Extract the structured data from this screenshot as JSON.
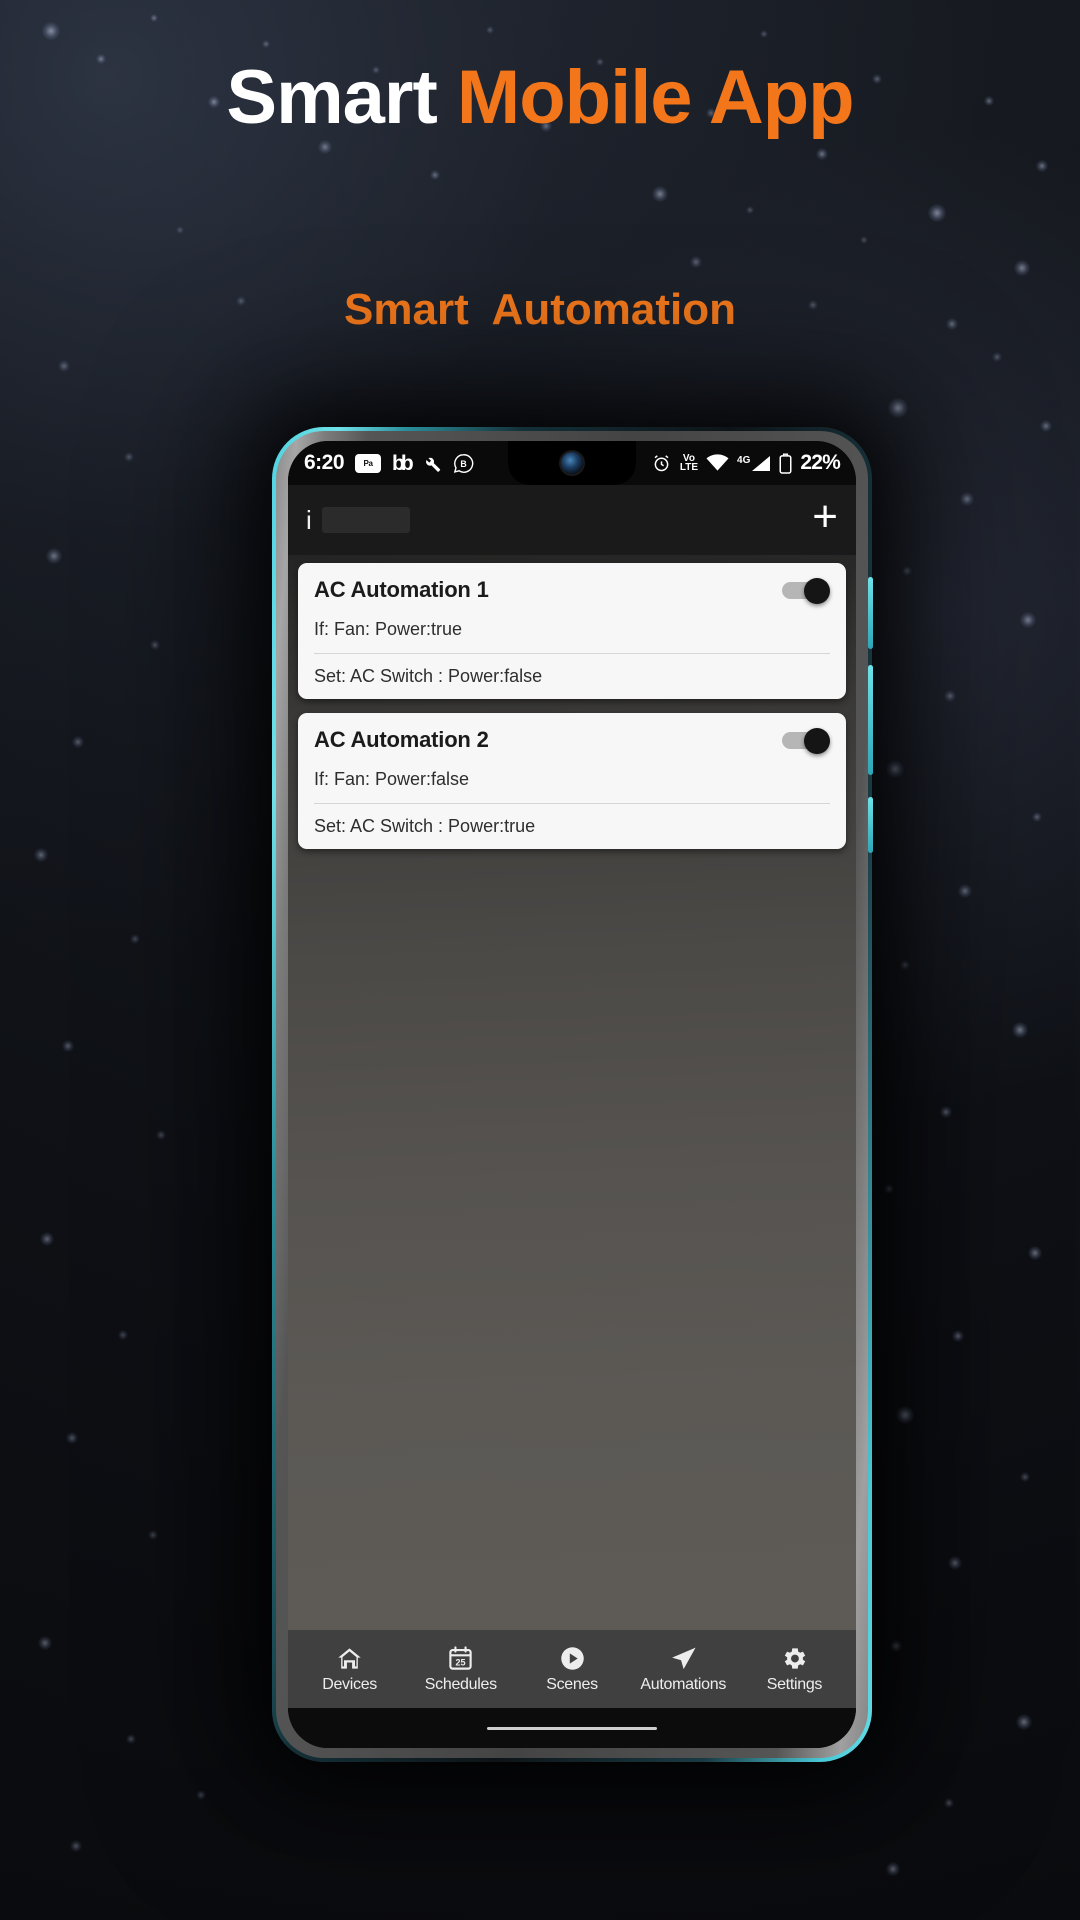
{
  "page": {
    "title_part_white": "Smart ",
    "title_part_orange": "Mobile App",
    "subtitle": "Smart  Automation",
    "colors": {
      "accent_orange": "#f4761b",
      "title_white": "#ffffff",
      "phone_bezel_cyan": "#4fd4e0",
      "card_background": "#f7f7f7",
      "nav_background": "#404040"
    }
  },
  "phone": {
    "status_bar": {
      "clock": "6:20",
      "left_icons": [
        {
          "name": "paytm-icon",
          "label": "Paytm"
        },
        {
          "name": "bb-icon",
          "label": "bb"
        },
        {
          "name": "wrench-icon",
          "label": "wrench"
        },
        {
          "name": "whatsapp-business-icon",
          "label": "B"
        }
      ],
      "right_icons": [
        {
          "name": "alarm-icon",
          "label": "alarm"
        },
        {
          "name": "volte-icon",
          "label": "VoLTE"
        },
        {
          "name": "wifi-icon",
          "label": "wifi"
        },
        {
          "name": "network-4g-icon",
          "label": "4G"
        },
        {
          "name": "battery-icon",
          "label": "battery"
        }
      ],
      "network_label": "4G",
      "volte_top": "Vo",
      "volte_bottom": "LTE",
      "battery_percent": "22%"
    },
    "app_header": {
      "info_label": "i",
      "add_label": "+"
    },
    "automations": [
      {
        "title": "AC Automation 1",
        "if_text": "If: Fan: Power:true",
        "set_text": "Set: AC Switch : Power:false",
        "enabled": true
      },
      {
        "title": "AC Automation 2",
        "if_text": "If: Fan: Power:false",
        "set_text": "Set: AC Switch : Power:true",
        "enabled": true
      }
    ],
    "bottom_nav": [
      {
        "label": "Devices",
        "icon": "home-icon"
      },
      {
        "label": "Schedules",
        "icon": "calendar-icon",
        "badge": "25"
      },
      {
        "label": "Scenes",
        "icon": "play-circle-icon"
      },
      {
        "label": "Automations",
        "icon": "send-icon"
      },
      {
        "label": "Settings",
        "icon": "gear-icon"
      }
    ]
  }
}
